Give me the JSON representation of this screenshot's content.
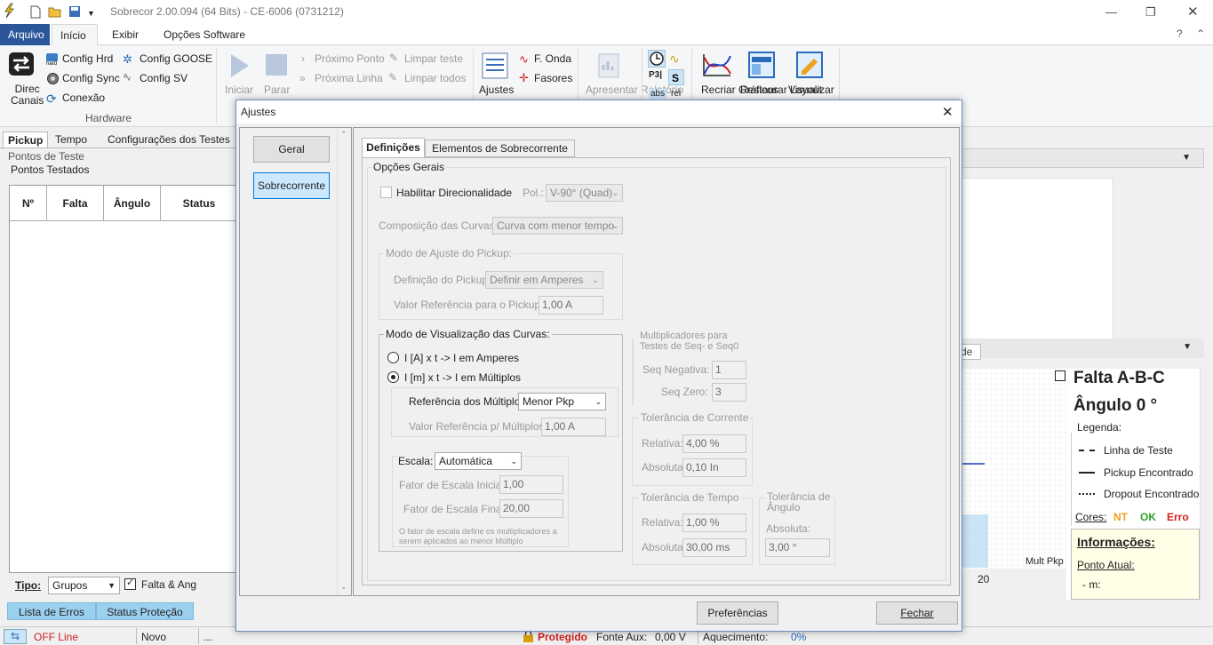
{
  "window": {
    "title": "Sobrecor 2.00.094 (64 Bits) - CE-6006 (0731212)"
  },
  "ribbon_tabs": [
    "Arquivo",
    "Início",
    "Exibir",
    "Opções Software"
  ],
  "ribbon": {
    "direc_canais": [
      "Direc",
      "Canais"
    ],
    "hardware": [
      "Config Hrd",
      "Config Sync",
      "Conexão",
      "Config GOOSE",
      "Config SV"
    ],
    "hardware_group": "Hardware",
    "run": [
      "Iniciar",
      "Parar"
    ],
    "nav": [
      "Próximo Ponto",
      "Próxima Linha",
      "Limpar teste",
      "Limpar todos"
    ],
    "ajustes": "Ajustes",
    "onda": [
      "F. Onda",
      "Fasores"
    ],
    "relatorio": "Apresentar Relatório",
    "toggles": [
      "abs",
      "rel"
    ],
    "graficos": [
      "Recriar Gráficos",
      "Restaurar Layout",
      "Visualizar"
    ]
  },
  "left": {
    "tabs": [
      "Pickup",
      "Tempo",
      "Configurações dos Testes"
    ],
    "section1": "Pontos de Teste",
    "section2": "Pontos Testados",
    "columns": [
      "Nº",
      "Falta",
      "Ângulo",
      "Status"
    ],
    "tipo_label": "Tipo:",
    "tipo_value": "Grupos",
    "falta_ang": "Falta & Ang",
    "bottom_tabs": [
      "Lista de Erros",
      "Status Proteção"
    ]
  },
  "status": {
    "offline": "OFF Line",
    "novo": "Novo",
    "dots": "...",
    "protegido": "Protegido",
    "fonte_aux_label": "Fonte Aux:",
    "fonte_aux": "0,00 V",
    "aquecimento_label": "Aquecimento:",
    "aquecimento": "0%"
  },
  "right": {
    "tab_fragment": "de",
    "falta": "Falta A-B-C",
    "angulo": "Ângulo 0 °",
    "legenda": "Legenda:",
    "legend": [
      "Linha de Teste",
      "Pickup Encontrado",
      "Dropout Encontrado"
    ],
    "cores": "Cores:",
    "cores_values": [
      "NT",
      "OK",
      "Erro"
    ],
    "colors": {
      "nt": "#f0a020",
      "ok": "#2aa02a",
      "erro": "#d02020"
    },
    "axis_label": "Mult Pkp",
    "axis_tick": "20",
    "info_title": "Informações:",
    "ponto_atual": "Ponto Atual:",
    "m": "- m:"
  },
  "dialog": {
    "title": "Ajustes",
    "nav": [
      "Geral",
      "Sobrecorrente"
    ],
    "tabs": [
      "Definições",
      "Elementos de Sobrecorrente"
    ],
    "opcoes_gerais": "Opções Gerais",
    "habilitar_direcionalidade": "Habilitar Direcionalidade",
    "pol_label": "Pol.:",
    "pol_value": "V-90° (Quad)",
    "composicao_label": "Composição das Curvas:",
    "composicao_value": "Curva com menor tempo",
    "modo_pickup_title": "Modo de Ajuste do Pickup:",
    "definicao_pickup_label": "Definição do Pickup:",
    "definicao_pickup_value": "Definir em Amperes",
    "valor_ref_pickup_label": "Valor Referência para o Pickup:",
    "valor_ref_pickup": "1,00 A",
    "modo_visual_title": "Modo de Visualização das Curvas:",
    "radio_amperes": "I [A] x t -> I em Amperes",
    "radio_multiplos": "I [m] x t -> I em Múltiplos",
    "ref_multiplos_label": "Referência dos Múltiplos:",
    "ref_multiplos_value": "Menor Pkp",
    "valor_ref_mult_label": "Valor Referência p/ Múltiplos:",
    "valor_ref_mult": "1,00 A",
    "escala_label": "Escala:",
    "escala_value": "Automática",
    "fator_inicial_label": "Fator de Escala Inicial:",
    "fator_inicial": "1,00",
    "fator_final_label": "Fator de Escala Final:",
    "fator_final": "20,00",
    "escala_note": [
      "O fator de escala define os multiplicadores a",
      "serem aplicados ao menor Múltiplo"
    ],
    "mult_title": [
      "Multiplicadores para",
      "Testes de Seq- e Seq0"
    ],
    "seq_neg_label": "Seq Negativa:",
    "seq_neg": "1",
    "seq_zero_label": "Seq Zero:",
    "seq_zero": "3",
    "tol_corrente_title": "Tolerância de Corrente",
    "relativa_label": "Relativa:",
    "tol_corr_rel": "4,00 %",
    "absoluta_label": "Absoluta:",
    "tol_corr_abs": "0,10 In",
    "tol_tempo_title": "Tolerância de Tempo",
    "tol_tempo_rel": "1,00 %",
    "tol_tempo_abs": "30,00 ms",
    "tol_angulo_title": [
      "Tolerância de",
      "Ângulo"
    ],
    "tol_ang_abs_label": "Absoluta:",
    "tol_ang_abs": "3,00 °",
    "preferencias": "Preferências",
    "fechar": "Fechar"
  }
}
